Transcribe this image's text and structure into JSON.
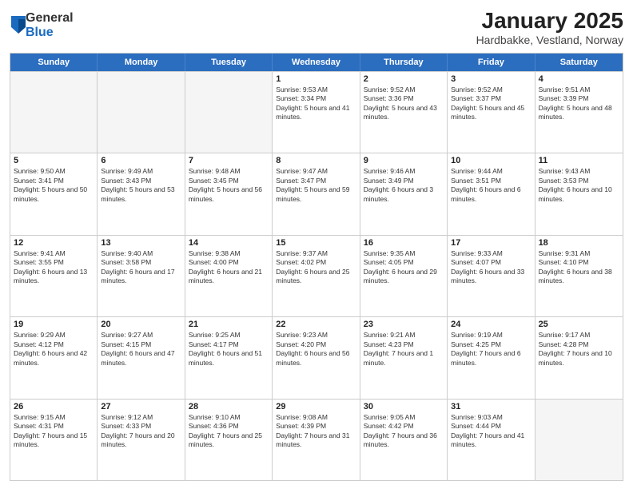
{
  "logo": {
    "general": "General",
    "blue": "Blue"
  },
  "title": "January 2025",
  "subtitle": "Hardbakke, Vestland, Norway",
  "header_days": [
    "Sunday",
    "Monday",
    "Tuesday",
    "Wednesday",
    "Thursday",
    "Friday",
    "Saturday"
  ],
  "weeks": [
    [
      {
        "day": "",
        "info": ""
      },
      {
        "day": "",
        "info": ""
      },
      {
        "day": "",
        "info": ""
      },
      {
        "day": "1",
        "info": "Sunrise: 9:53 AM\nSunset: 3:34 PM\nDaylight: 5 hours and 41 minutes."
      },
      {
        "day": "2",
        "info": "Sunrise: 9:52 AM\nSunset: 3:36 PM\nDaylight: 5 hours and 43 minutes."
      },
      {
        "day": "3",
        "info": "Sunrise: 9:52 AM\nSunset: 3:37 PM\nDaylight: 5 hours and 45 minutes."
      },
      {
        "day": "4",
        "info": "Sunrise: 9:51 AM\nSunset: 3:39 PM\nDaylight: 5 hours and 48 minutes."
      }
    ],
    [
      {
        "day": "5",
        "info": "Sunrise: 9:50 AM\nSunset: 3:41 PM\nDaylight: 5 hours and 50 minutes."
      },
      {
        "day": "6",
        "info": "Sunrise: 9:49 AM\nSunset: 3:43 PM\nDaylight: 5 hours and 53 minutes."
      },
      {
        "day": "7",
        "info": "Sunrise: 9:48 AM\nSunset: 3:45 PM\nDaylight: 5 hours and 56 minutes."
      },
      {
        "day": "8",
        "info": "Sunrise: 9:47 AM\nSunset: 3:47 PM\nDaylight: 5 hours and 59 minutes."
      },
      {
        "day": "9",
        "info": "Sunrise: 9:46 AM\nSunset: 3:49 PM\nDaylight: 6 hours and 3 minutes."
      },
      {
        "day": "10",
        "info": "Sunrise: 9:44 AM\nSunset: 3:51 PM\nDaylight: 6 hours and 6 minutes."
      },
      {
        "day": "11",
        "info": "Sunrise: 9:43 AM\nSunset: 3:53 PM\nDaylight: 6 hours and 10 minutes."
      }
    ],
    [
      {
        "day": "12",
        "info": "Sunrise: 9:41 AM\nSunset: 3:55 PM\nDaylight: 6 hours and 13 minutes."
      },
      {
        "day": "13",
        "info": "Sunrise: 9:40 AM\nSunset: 3:58 PM\nDaylight: 6 hours and 17 minutes."
      },
      {
        "day": "14",
        "info": "Sunrise: 9:38 AM\nSunset: 4:00 PM\nDaylight: 6 hours and 21 minutes."
      },
      {
        "day": "15",
        "info": "Sunrise: 9:37 AM\nSunset: 4:02 PM\nDaylight: 6 hours and 25 minutes."
      },
      {
        "day": "16",
        "info": "Sunrise: 9:35 AM\nSunset: 4:05 PM\nDaylight: 6 hours and 29 minutes."
      },
      {
        "day": "17",
        "info": "Sunrise: 9:33 AM\nSunset: 4:07 PM\nDaylight: 6 hours and 33 minutes."
      },
      {
        "day": "18",
        "info": "Sunrise: 9:31 AM\nSunset: 4:10 PM\nDaylight: 6 hours and 38 minutes."
      }
    ],
    [
      {
        "day": "19",
        "info": "Sunrise: 9:29 AM\nSunset: 4:12 PM\nDaylight: 6 hours and 42 minutes."
      },
      {
        "day": "20",
        "info": "Sunrise: 9:27 AM\nSunset: 4:15 PM\nDaylight: 6 hours and 47 minutes."
      },
      {
        "day": "21",
        "info": "Sunrise: 9:25 AM\nSunset: 4:17 PM\nDaylight: 6 hours and 51 minutes."
      },
      {
        "day": "22",
        "info": "Sunrise: 9:23 AM\nSunset: 4:20 PM\nDaylight: 6 hours and 56 minutes."
      },
      {
        "day": "23",
        "info": "Sunrise: 9:21 AM\nSunset: 4:23 PM\nDaylight: 7 hours and 1 minute."
      },
      {
        "day": "24",
        "info": "Sunrise: 9:19 AM\nSunset: 4:25 PM\nDaylight: 7 hours and 6 minutes."
      },
      {
        "day": "25",
        "info": "Sunrise: 9:17 AM\nSunset: 4:28 PM\nDaylight: 7 hours and 10 minutes."
      }
    ],
    [
      {
        "day": "26",
        "info": "Sunrise: 9:15 AM\nSunset: 4:31 PM\nDaylight: 7 hours and 15 minutes."
      },
      {
        "day": "27",
        "info": "Sunrise: 9:12 AM\nSunset: 4:33 PM\nDaylight: 7 hours and 20 minutes."
      },
      {
        "day": "28",
        "info": "Sunrise: 9:10 AM\nSunset: 4:36 PM\nDaylight: 7 hours and 25 minutes."
      },
      {
        "day": "29",
        "info": "Sunrise: 9:08 AM\nSunset: 4:39 PM\nDaylight: 7 hours and 31 minutes."
      },
      {
        "day": "30",
        "info": "Sunrise: 9:05 AM\nSunset: 4:42 PM\nDaylight: 7 hours and 36 minutes."
      },
      {
        "day": "31",
        "info": "Sunrise: 9:03 AM\nSunset: 4:44 PM\nDaylight: 7 hours and 41 minutes."
      },
      {
        "day": "",
        "info": ""
      }
    ]
  ]
}
